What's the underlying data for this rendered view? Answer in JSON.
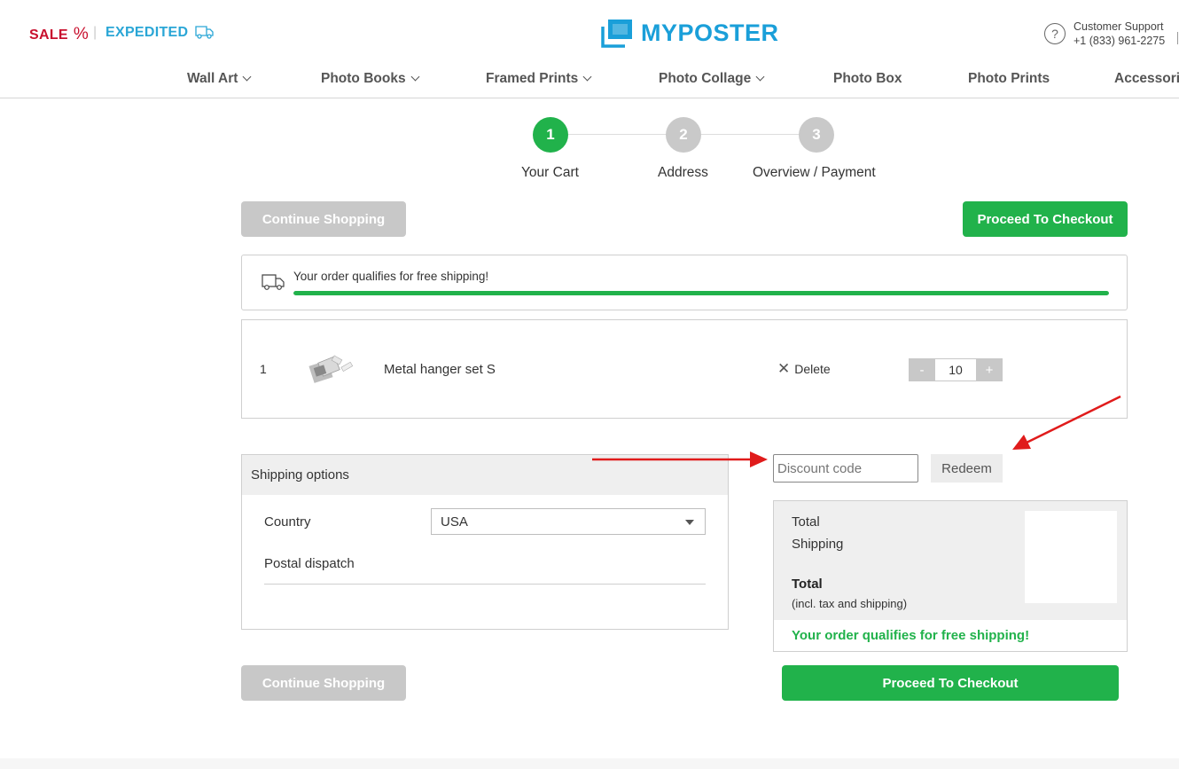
{
  "header": {
    "sale_label": "SALE",
    "sale_symbol": "%",
    "separator": "|",
    "expedited_label": "EXPEDITED",
    "logo_text": "MYPOSTER",
    "support_title": "Customer Support",
    "support_phone": "+1 (833) 961-2275"
  },
  "nav": {
    "items": [
      {
        "label": "Wall Art",
        "dropdown": true
      },
      {
        "label": "Photo Books",
        "dropdown": true
      },
      {
        "label": "Framed Prints",
        "dropdown": true
      },
      {
        "label": "Photo Collage",
        "dropdown": true
      },
      {
        "label": "Photo Box",
        "dropdown": false
      },
      {
        "label": "Photo Prints",
        "dropdown": false
      },
      {
        "label": "Accessori",
        "dropdown": false
      }
    ]
  },
  "steps": [
    {
      "number": "1",
      "label": "Your Cart",
      "active": true
    },
    {
      "number": "2",
      "label": "Address",
      "active": false
    },
    {
      "number": "3",
      "label": "Overview / Payment",
      "active": false
    }
  ],
  "buttons": {
    "continue_shopping": "Continue Shopping",
    "proceed_checkout": "Proceed To Checkout"
  },
  "free_shipping_banner": {
    "message": "Your order qualifies for free shipping!",
    "progress_percent": 100
  },
  "cart": {
    "items": [
      {
        "index": "1",
        "name": "Metal hanger set S",
        "delete_label": "Delete",
        "delete_icon": "x-icon",
        "quantity": "10",
        "minus": "-",
        "plus": "+"
      }
    ]
  },
  "shipping_options": {
    "title": "Shipping options",
    "country_label": "Country",
    "country_value": "USA",
    "dispatch_label": "Postal dispatch"
  },
  "discount": {
    "placeholder": "Discount code",
    "redeem_label": "Redeem"
  },
  "totals": {
    "total_label": "Total",
    "shipping_label": "Shipping",
    "grand_total_label": "Total",
    "incl_note": "(incl. tax and shipping)",
    "free_shipping_note": "Your order qualifies for free shipping!"
  },
  "colors": {
    "brand_blue": "#1a9fd9",
    "sale_red": "#c8102e",
    "accent_green": "#21b24b",
    "annotation_red": "#e01b1b"
  }
}
